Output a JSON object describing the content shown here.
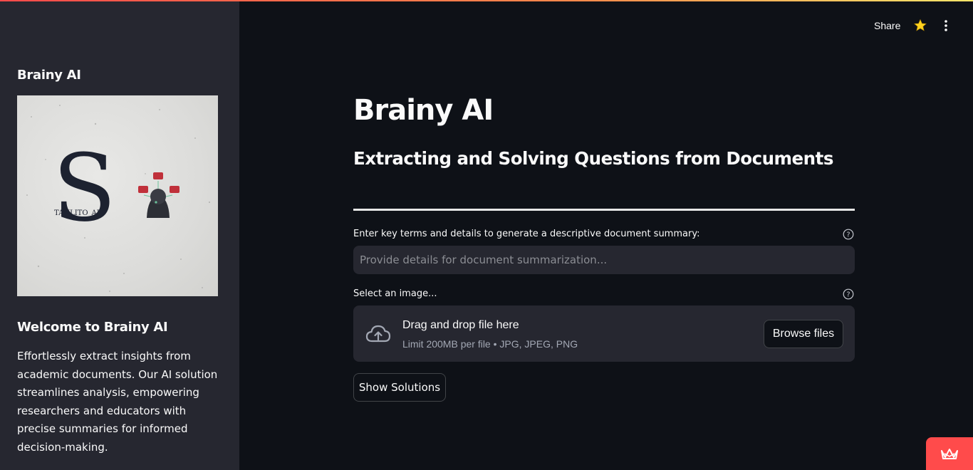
{
  "sidebar": {
    "title": "Brainy AI",
    "logo_text": "TANLITO_AI",
    "welcome_heading": "Welcome to Brainy AI",
    "description": "Effortlessly extract insights from academic documents. Our AI solution streamlines analysis, empowering researchers and educators with precise summaries for informed decision-making."
  },
  "topbar": {
    "share_label": "Share",
    "icons": [
      "star-icon",
      "more-vertical-icon"
    ]
  },
  "main": {
    "title": "Brainy AI",
    "subtitle": "Extracting and Solving Questions from Documents",
    "summary_field": {
      "label": "Enter key terms and details to generate a descriptive document summary:",
      "placeholder": "Provide details for document summarization...",
      "value": ""
    },
    "image_field": {
      "label": "Select an image...",
      "dropzone_title": "Drag and drop file here",
      "dropzone_limit": "Limit 200MB per file • JPG, JPEG, PNG",
      "browse_label": "Browse files"
    },
    "show_solutions_label": "Show Solutions"
  },
  "colors": {
    "background": "#0e1117",
    "sidebar": "#262730",
    "accent": "#ff4b4b",
    "star": "#ffd21f"
  }
}
